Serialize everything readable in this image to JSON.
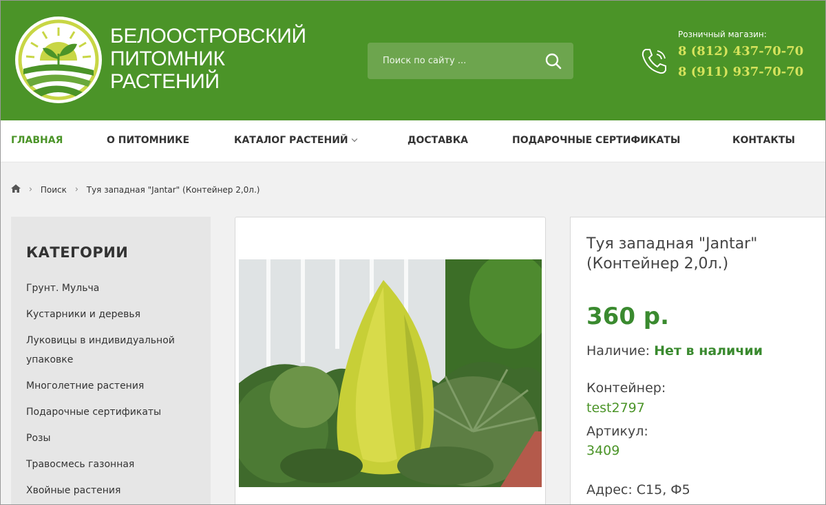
{
  "header": {
    "brand_lines": [
      "БЕЛООСТРОВСКИЙ",
      "ПИТОМНИК",
      "РАСТЕНИЙ"
    ],
    "search_placeholder": "Поиск по сайту ...",
    "retail_label": "Розничный магазин:",
    "phones": [
      "8 (812) 437-70-70",
      "8 (911) 937-70-70"
    ]
  },
  "nav": {
    "items": [
      "ГЛАВНАЯ",
      "О ПИТОМНИКЕ",
      "КАТАЛОГ РАСТЕНИЙ",
      "ДОСТАВКА",
      "ПОДАРОЧНЫЕ СЕРТИФИКАТЫ",
      "КОНТАКТЫ"
    ],
    "active": "ГЛАВНАЯ"
  },
  "breadcrumb": {
    "items": [
      "Поиск",
      "Туя западная \"Jantar\" (Контейнер 2,0л.)"
    ]
  },
  "sidebar": {
    "title": "КАТЕГОРИИ",
    "items": [
      "Грунт. Мульча",
      "Кустарники и деревья",
      "Луковицы в индивидуальной упаковке",
      "Многолетние растения",
      "Подарочные сертификаты",
      "Розы",
      "Травосмесь газонная",
      "Хвойные растения"
    ]
  },
  "product": {
    "title": "Туя западная \"Jantar\" (Контейнер 2,0л.)",
    "price": "360 р.",
    "availability_label": "Наличие:",
    "availability_value": "Нет в наличии",
    "container_label": "Контейнер:",
    "container_value": "test2797",
    "article_label": "Артикул:",
    "article_value": "3409",
    "address": "Адрес: С15, Ф5"
  },
  "colors": {
    "header_green": "#4b9428",
    "accent_green": "#3a8a2f",
    "phone_yellow": "#d6e35c"
  },
  "icons": [
    "logo-emblem-icon",
    "search-icon",
    "phone-icon",
    "home-icon",
    "chevron-down-icon",
    "chevron-right-icon"
  ]
}
